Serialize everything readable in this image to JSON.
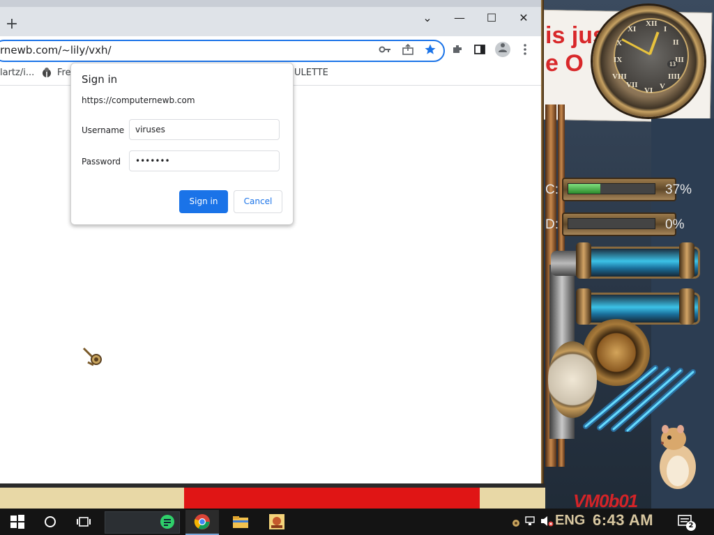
{
  "desktop": {
    "banner_line1": "is jus",
    "banner_line2": "e O",
    "clock_numerals": [
      "XII",
      "I",
      "II",
      "III",
      "IIII",
      "V",
      "VI",
      "VII",
      "VIII",
      "IX",
      "X",
      "XI"
    ],
    "clock_center": "13",
    "gauges": [
      {
        "prefix": "C:",
        "value_text": "37%",
        "fill": 0.37
      },
      {
        "prefix": "D:",
        "value_text": "0%",
        "fill": 0.0
      }
    ],
    "watermark": "VM0b01"
  },
  "browser": {
    "new_tab_label": "+",
    "url": "rnewb.com/~lily/vxh/",
    "bookmarks": [
      {
        "label": "lartz/i...",
        "icon": "page-icon"
      },
      {
        "label": "Fre",
        "icon": "bug-icon"
      },
      {
        "label": "ULETTE",
        "icon": "none"
      }
    ],
    "window_controls": {
      "dropdown": "⌄",
      "minimize": "—",
      "maximize": "☐",
      "close": "✕"
    }
  },
  "dialog": {
    "title": "Sign in",
    "origin": "https://computernewb.com",
    "username_label": "Username",
    "username_value": "viruses",
    "password_label": "Password",
    "password_value": "•••••••",
    "signin_label": "Sign in",
    "cancel_label": "Cancel"
  },
  "taskbar": {
    "time": "6:43 AM",
    "language": "ENG",
    "notification_count": "2"
  },
  "colors": {
    "accent": "#1a73e8",
    "taskbar": "#141414",
    "banner_red": "#d8282a",
    "gauge_green": "#2b8a2b"
  }
}
